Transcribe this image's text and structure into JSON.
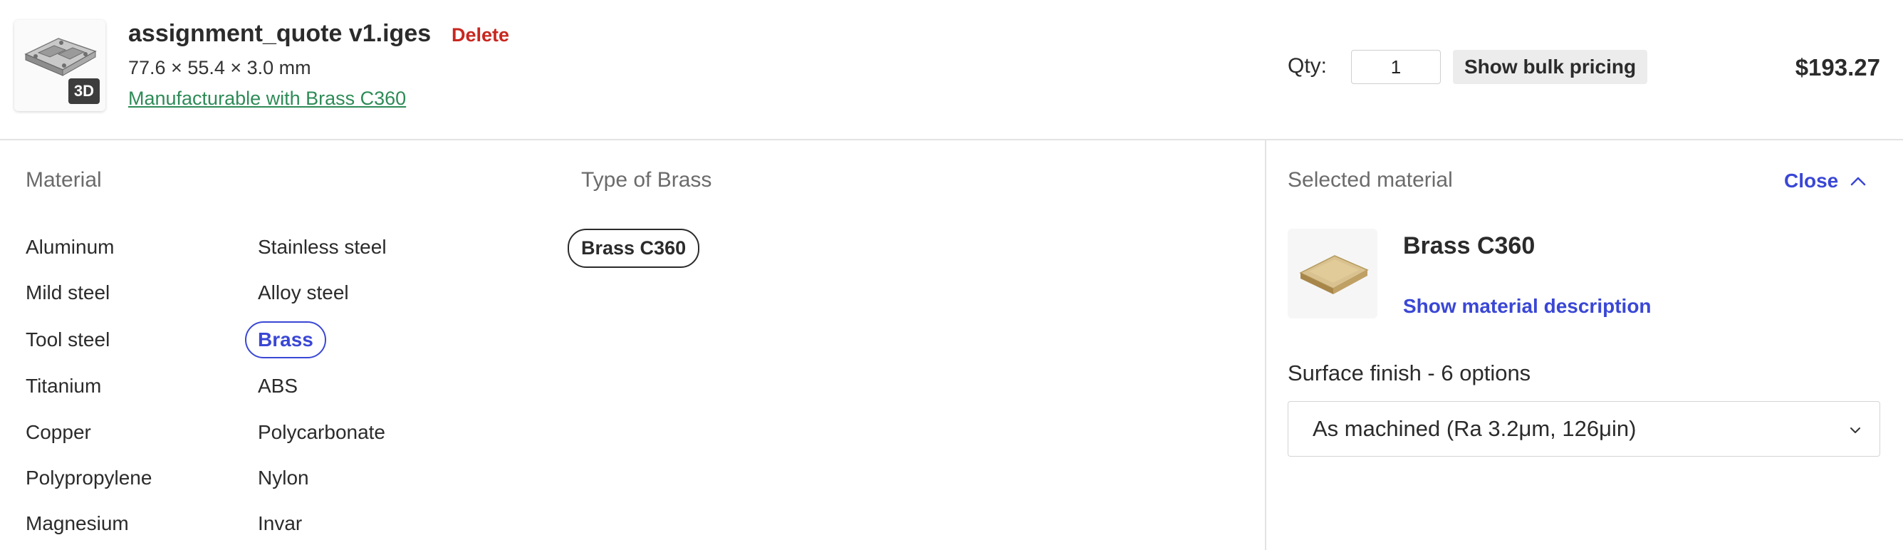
{
  "part": {
    "thumbnail_badge": "3D",
    "file_name": "assignment_quote v1.iges",
    "delete_label": "Delete",
    "dimensions": "77.6 × 55.4 × 3.0 mm",
    "manufacturable_label": "Manufacturable with Brass C360"
  },
  "order": {
    "qty_label": "Qty:",
    "qty_value": "1",
    "bulk_pricing_label": "Show bulk pricing",
    "price": "$193.27"
  },
  "material_panel": {
    "title": "Material",
    "column_1": [
      "Aluminum",
      "Mild steel",
      "Tool steel",
      "Titanium",
      "Copper",
      "Polypropylene",
      "Magnesium"
    ],
    "column_2": [
      "Stainless steel",
      "Alloy steel",
      "Brass",
      "ABS",
      "Polycarbonate",
      "Nylon",
      "Invar"
    ],
    "selected": "Brass"
  },
  "type_panel": {
    "title": "Type of Brass",
    "options": [
      "Brass C360"
    ],
    "selected": "Brass C360"
  },
  "selected_panel": {
    "title": "Selected material",
    "close_label": "Close",
    "material_name": "Brass C360",
    "description_link": "Show material description",
    "surface_finish_label": "Surface finish - 6 options",
    "surface_finish_value": "As machined (Ra 3.2μm, 126μin)"
  },
  "colors": {
    "accent_blue": "#3a47d5",
    "delete_red": "#c8271f",
    "manufacturable_green": "#2e8b57"
  },
  "icons": [
    "3d-part-thumbnail-icon",
    "chevron-up-icon",
    "chevron-down-icon",
    "brass-plate-icon"
  ]
}
